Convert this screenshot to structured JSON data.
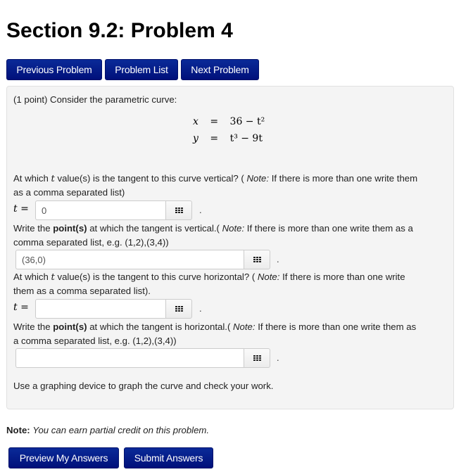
{
  "page": {
    "title": "Section 9.2: Problem 4"
  },
  "nav": {
    "previous": "Previous Problem",
    "list": "Problem List",
    "next": "Next Problem"
  },
  "problem": {
    "intro": "(1 point) Consider the parametric curve:",
    "equations": [
      {
        "lhs": "x",
        "rhs": "36 − t²"
      },
      {
        "lhs": "y",
        "rhs": "t³ − 9t"
      }
    ],
    "q1": {
      "line1_a": "At which ",
      "var": "t",
      "line1_b": " value(s) is the tangent to this curve vertical? ( ",
      "note_label": "Note:",
      "line1_c": " If there is more than one write them",
      "line2": "as a comma separated list)",
      "prefix": "t =",
      "value": "0"
    },
    "q2": {
      "line1_a": "Write the ",
      "bold": "point(s)",
      "line1_b": " at which the tangent is vertical.( ",
      "note_label": "Note:",
      "line1_c": " If there is more than one write them as a",
      "line2": "comma separated list, e.g. (1,2),(3,4))",
      "value": "(36,0)"
    },
    "q3": {
      "line1_a": "At which ",
      "var": "t",
      "line1_b": " value(s) is the tangent to this curve horizontal? ( ",
      "note_label": "Note:",
      "line1_c": " If there is more than one write",
      "line2": "them as a comma separated list).",
      "prefix": "t =",
      "value": ""
    },
    "q4": {
      "line1_a": "Write the ",
      "bold": "point(s)",
      "line1_b": " at which the tangent is horizontal.( ",
      "note_label": "Note:",
      "line1_c": " If there is more than one write them as",
      "line2": "a comma separated list, e.g. (1,2),(3,4))",
      "value": ""
    },
    "footer_text": "Use a graphing device to graph the curve and check your work.",
    "period": "."
  },
  "note": {
    "label": "Note:",
    "text": "You can earn partial credit on this problem."
  },
  "actions": {
    "preview": "Preview My Answers",
    "submit": "Submit Answers"
  },
  "icons": {
    "keypad": "keypad-grid-icon"
  }
}
